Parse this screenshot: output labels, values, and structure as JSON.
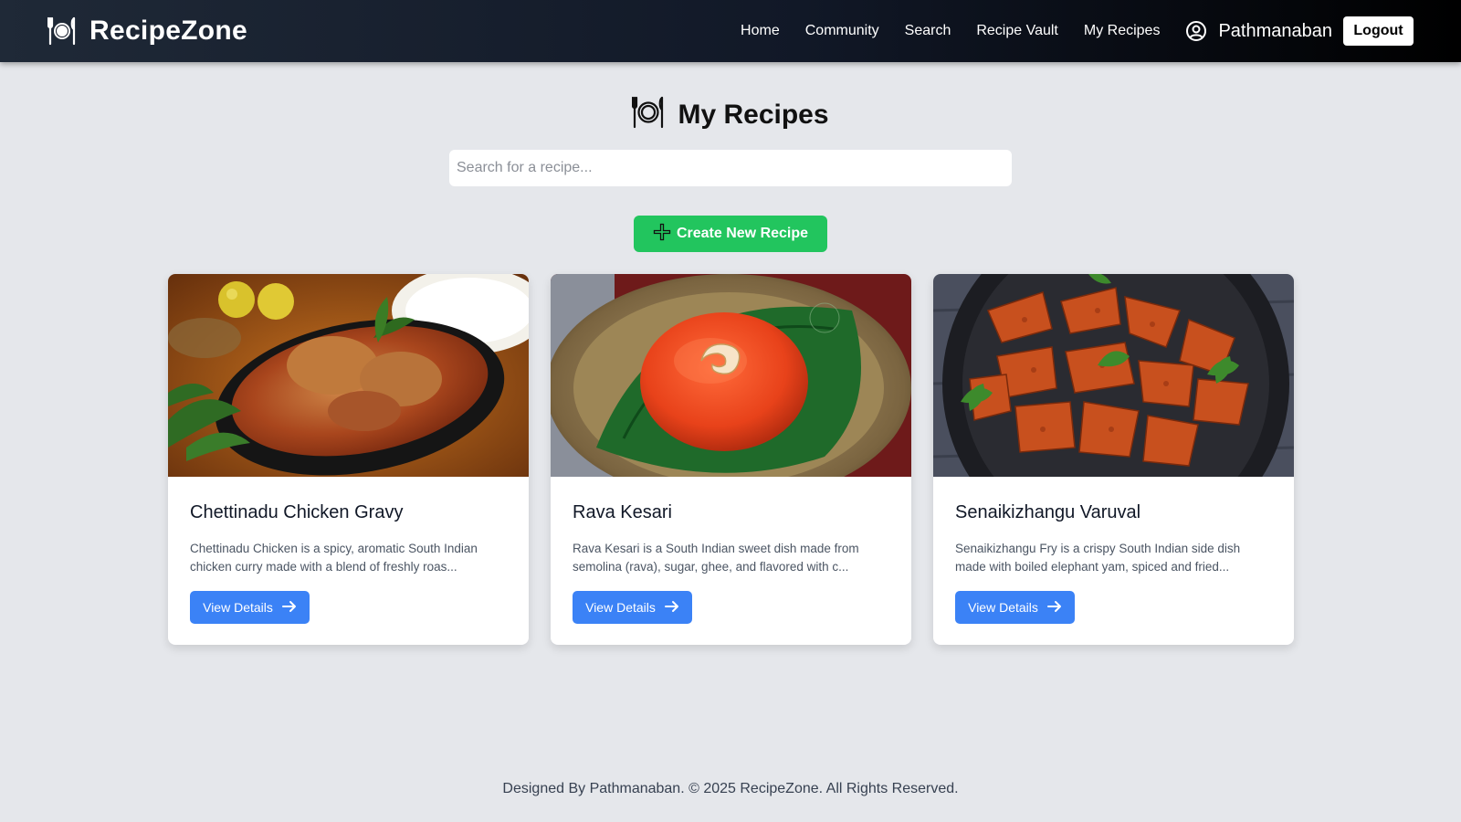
{
  "navbar": {
    "brand_name": "RecipeZone",
    "brand_icon": "plate-cutlery-icon",
    "links": [
      "Home",
      "Community",
      "Search",
      "Recipe Vault",
      "My Recipes"
    ],
    "user_name": "Pathmanaban",
    "user_icon": "user-circle-icon",
    "logout_label": "Logout"
  },
  "page": {
    "title": "My Recipes",
    "search_placeholder": "Search for a recipe...",
    "create_label": "Create New Recipe"
  },
  "recipes": [
    {
      "title": "Chettinadu Chicken Gravy",
      "description": "Chettinadu Chicken is a spicy, aromatic South Indian chicken curry made with a blend of freshly roas...",
      "button_label": "View Details"
    },
    {
      "title": "Rava Kesari",
      "description": "Rava Kesari is a South Indian sweet dish made from semolina (rava), sugar, ghee, and flavored with c...",
      "button_label": "View Details"
    },
    {
      "title": "Senaikizhangu Varuval",
      "description": "Senaikizhangu Fry is a crispy South Indian side dish made with boiled elephant yam, spiced and fried...",
      "button_label": "View Details"
    }
  ],
  "footer": {
    "text": "Designed By Pathmanaban. © 2025 RecipeZone. All Rights Reserved."
  },
  "colors": {
    "create_button": "#22c55e",
    "view_button": "#3b82f6",
    "page_background": "#e5e7eb",
    "navbar": "#111827"
  }
}
